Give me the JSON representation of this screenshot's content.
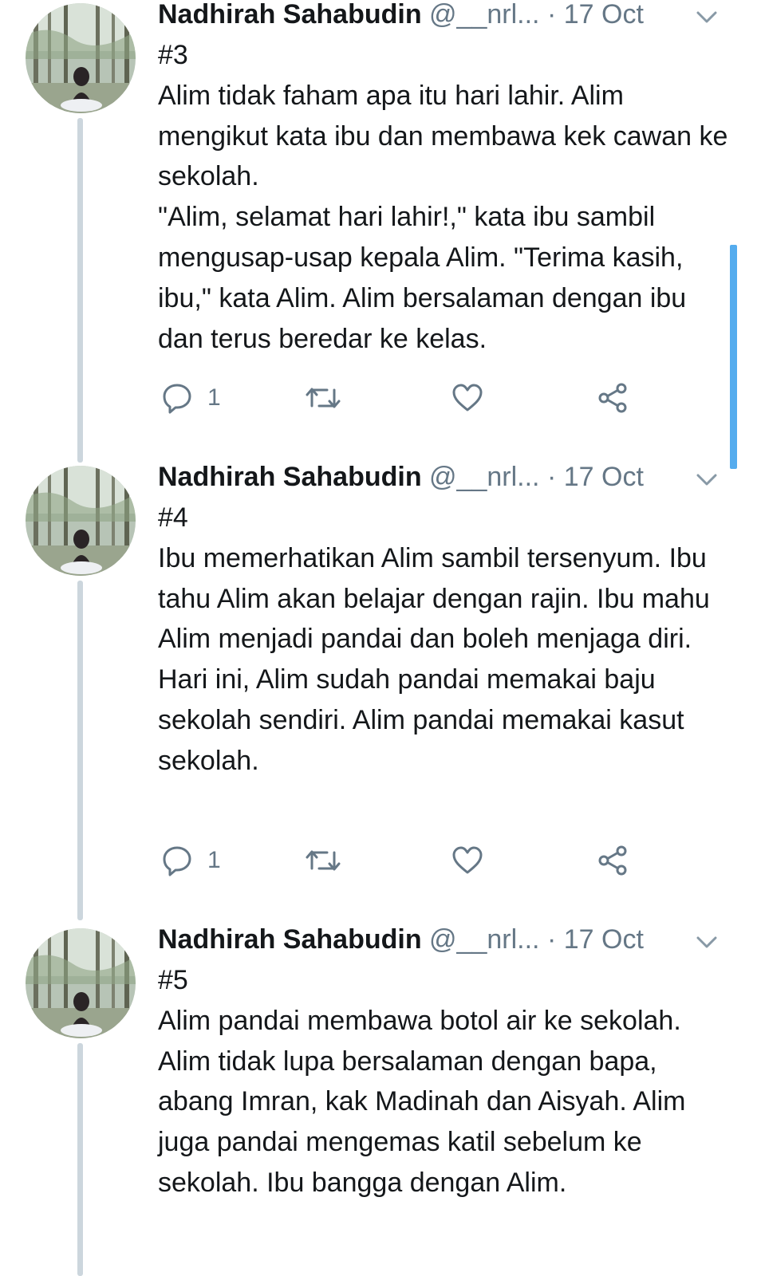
{
  "colors": {
    "accent": "#1da1f2",
    "thread_line": "#ccd6dd",
    "meta": "#657786",
    "text": "#14171a"
  },
  "tweets": [
    {
      "name": "Nadhirah Sahabudin",
      "handle": "@__nrl...",
      "date": "· 17 Oct",
      "text": "#3\nAlim tidak faham apa itu hari lahir. Alim mengikut kata ibu dan membawa kek cawan ke sekolah.\n\"Alim, selamat hari lahir!,\" kata ibu sambil mengusap-usap kepala Alim. \"Terima kasih, ibu,\" kata Alim. Alim bersalaman dengan ibu dan terus beredar ke kelas.",
      "reply_count": "1"
    },
    {
      "name": "Nadhirah Sahabudin",
      "handle": "@__nrl...",
      "date": "· 17 Oct",
      "text": "#4\nIbu memerhatikan Alim sambil tersenyum. Ibu tahu Alim akan belajar dengan rajin. Ibu mahu Alim menjadi pandai dan boleh menjaga diri. Hari ini, Alim sudah pandai memakai baju sekolah sendiri. Alim pandai memakai kasut sekolah.",
      "reply_count": "1"
    },
    {
      "name": "Nadhirah Sahabudin",
      "handle": "@__nrl...",
      "date": "· 17 Oct",
      "text": "#5\nAlim pandai membawa botol air ke sekolah. Alim tidak lupa bersalaman dengan bapa, abang Imran, kak Madinah dan Aisyah. Alim juga pandai mengemas katil sebelum ke sekolah. Ibu bangga dengan Alim.",
      "reply_count": ""
    }
  ],
  "icons": [
    "reply-icon",
    "retweet-icon",
    "like-icon",
    "share-icon",
    "chevron-down-icon"
  ]
}
